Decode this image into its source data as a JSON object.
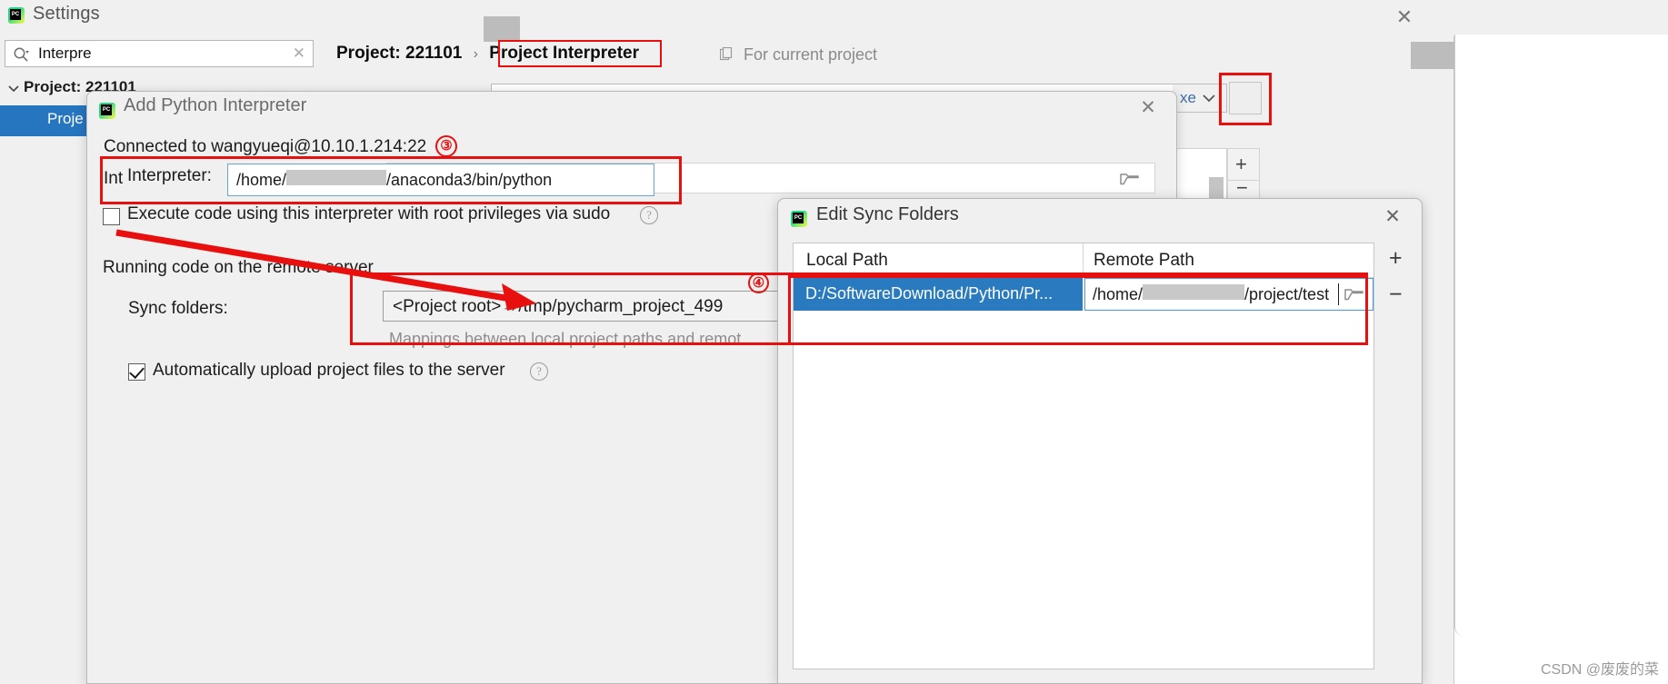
{
  "settings_window": {
    "title": "Settings",
    "logo": "pycharm-logo",
    "close_label": "✕",
    "search": {
      "value": "Interpre",
      "placeholder": "",
      "clear_label": "✕",
      "icon": "search-icon"
    },
    "tree": {
      "root_label": "Project: 221101",
      "selected_label": "Proje"
    },
    "breadcrumb": {
      "parent": "Project: 221101",
      "separator": "›",
      "current": "Project Interpreter"
    },
    "for_current_project": "For current project",
    "interpreter_combo": {
      "visible_text": "xe",
      "chevron": "chevron-down-icon"
    },
    "gear_button_tooltip": "gear-icon",
    "package_buttons": {
      "add": "+",
      "remove": "−"
    }
  },
  "add_interpreter_dialog": {
    "title": "Add Python Interpreter",
    "logo": "pycharm-logo",
    "close_label": "✕",
    "connected_text": "Connected to wangyueqi@10.10.1.214:22",
    "marker": "③",
    "interpreter_label_behind": "Int",
    "interpreter_label": "Interpreter:",
    "interpreter_value_prefix": "/home/",
    "interpreter_value_suffix": "/anaconda3/bin/python",
    "browse_icon": "folder-icon",
    "sudo_checkbox": {
      "label": "Execute code using this interpreter with root privileges via sudo",
      "checked": false,
      "help": "?"
    },
    "running_section_label": "Running code on the remote server",
    "sync_folders_label": "Sync folders:",
    "sync_folders_value": "<Project root>→/tmp/pycharm_project_499",
    "sync_hint": "Mappings between local project paths and remot",
    "auto_upload_checkbox": {
      "label": "Automatically upload project files to the server",
      "checked": true,
      "help": "?"
    }
  },
  "edit_sync_folders_dialog": {
    "title": "Edit Sync Folders",
    "logo": "pycharm-logo",
    "close_label": "✕",
    "marker": "④",
    "columns": [
      "Local Path",
      "Remote Path"
    ],
    "rows": [
      {
        "local_path": "D:/SoftwareDownload/Python/Pr...",
        "remote_path_prefix": "/home/",
        "remote_path_suffix": "/project/test",
        "selected": true,
        "editing": true
      }
    ],
    "add_label": "+",
    "remove_label": "−",
    "browse_icon": "folder-icon"
  },
  "annotations": {
    "accent_color": "#e8100f",
    "selection_color": "#2a7ac0",
    "boxes": [
      "project-interpreter-crumb",
      "interpreter-field",
      "sync-folders-field",
      "sync-folder-row",
      "gear-button"
    ],
    "arrow": "red-arrow-to-sync-folders"
  },
  "watermark": "CSDN @废废的菜"
}
